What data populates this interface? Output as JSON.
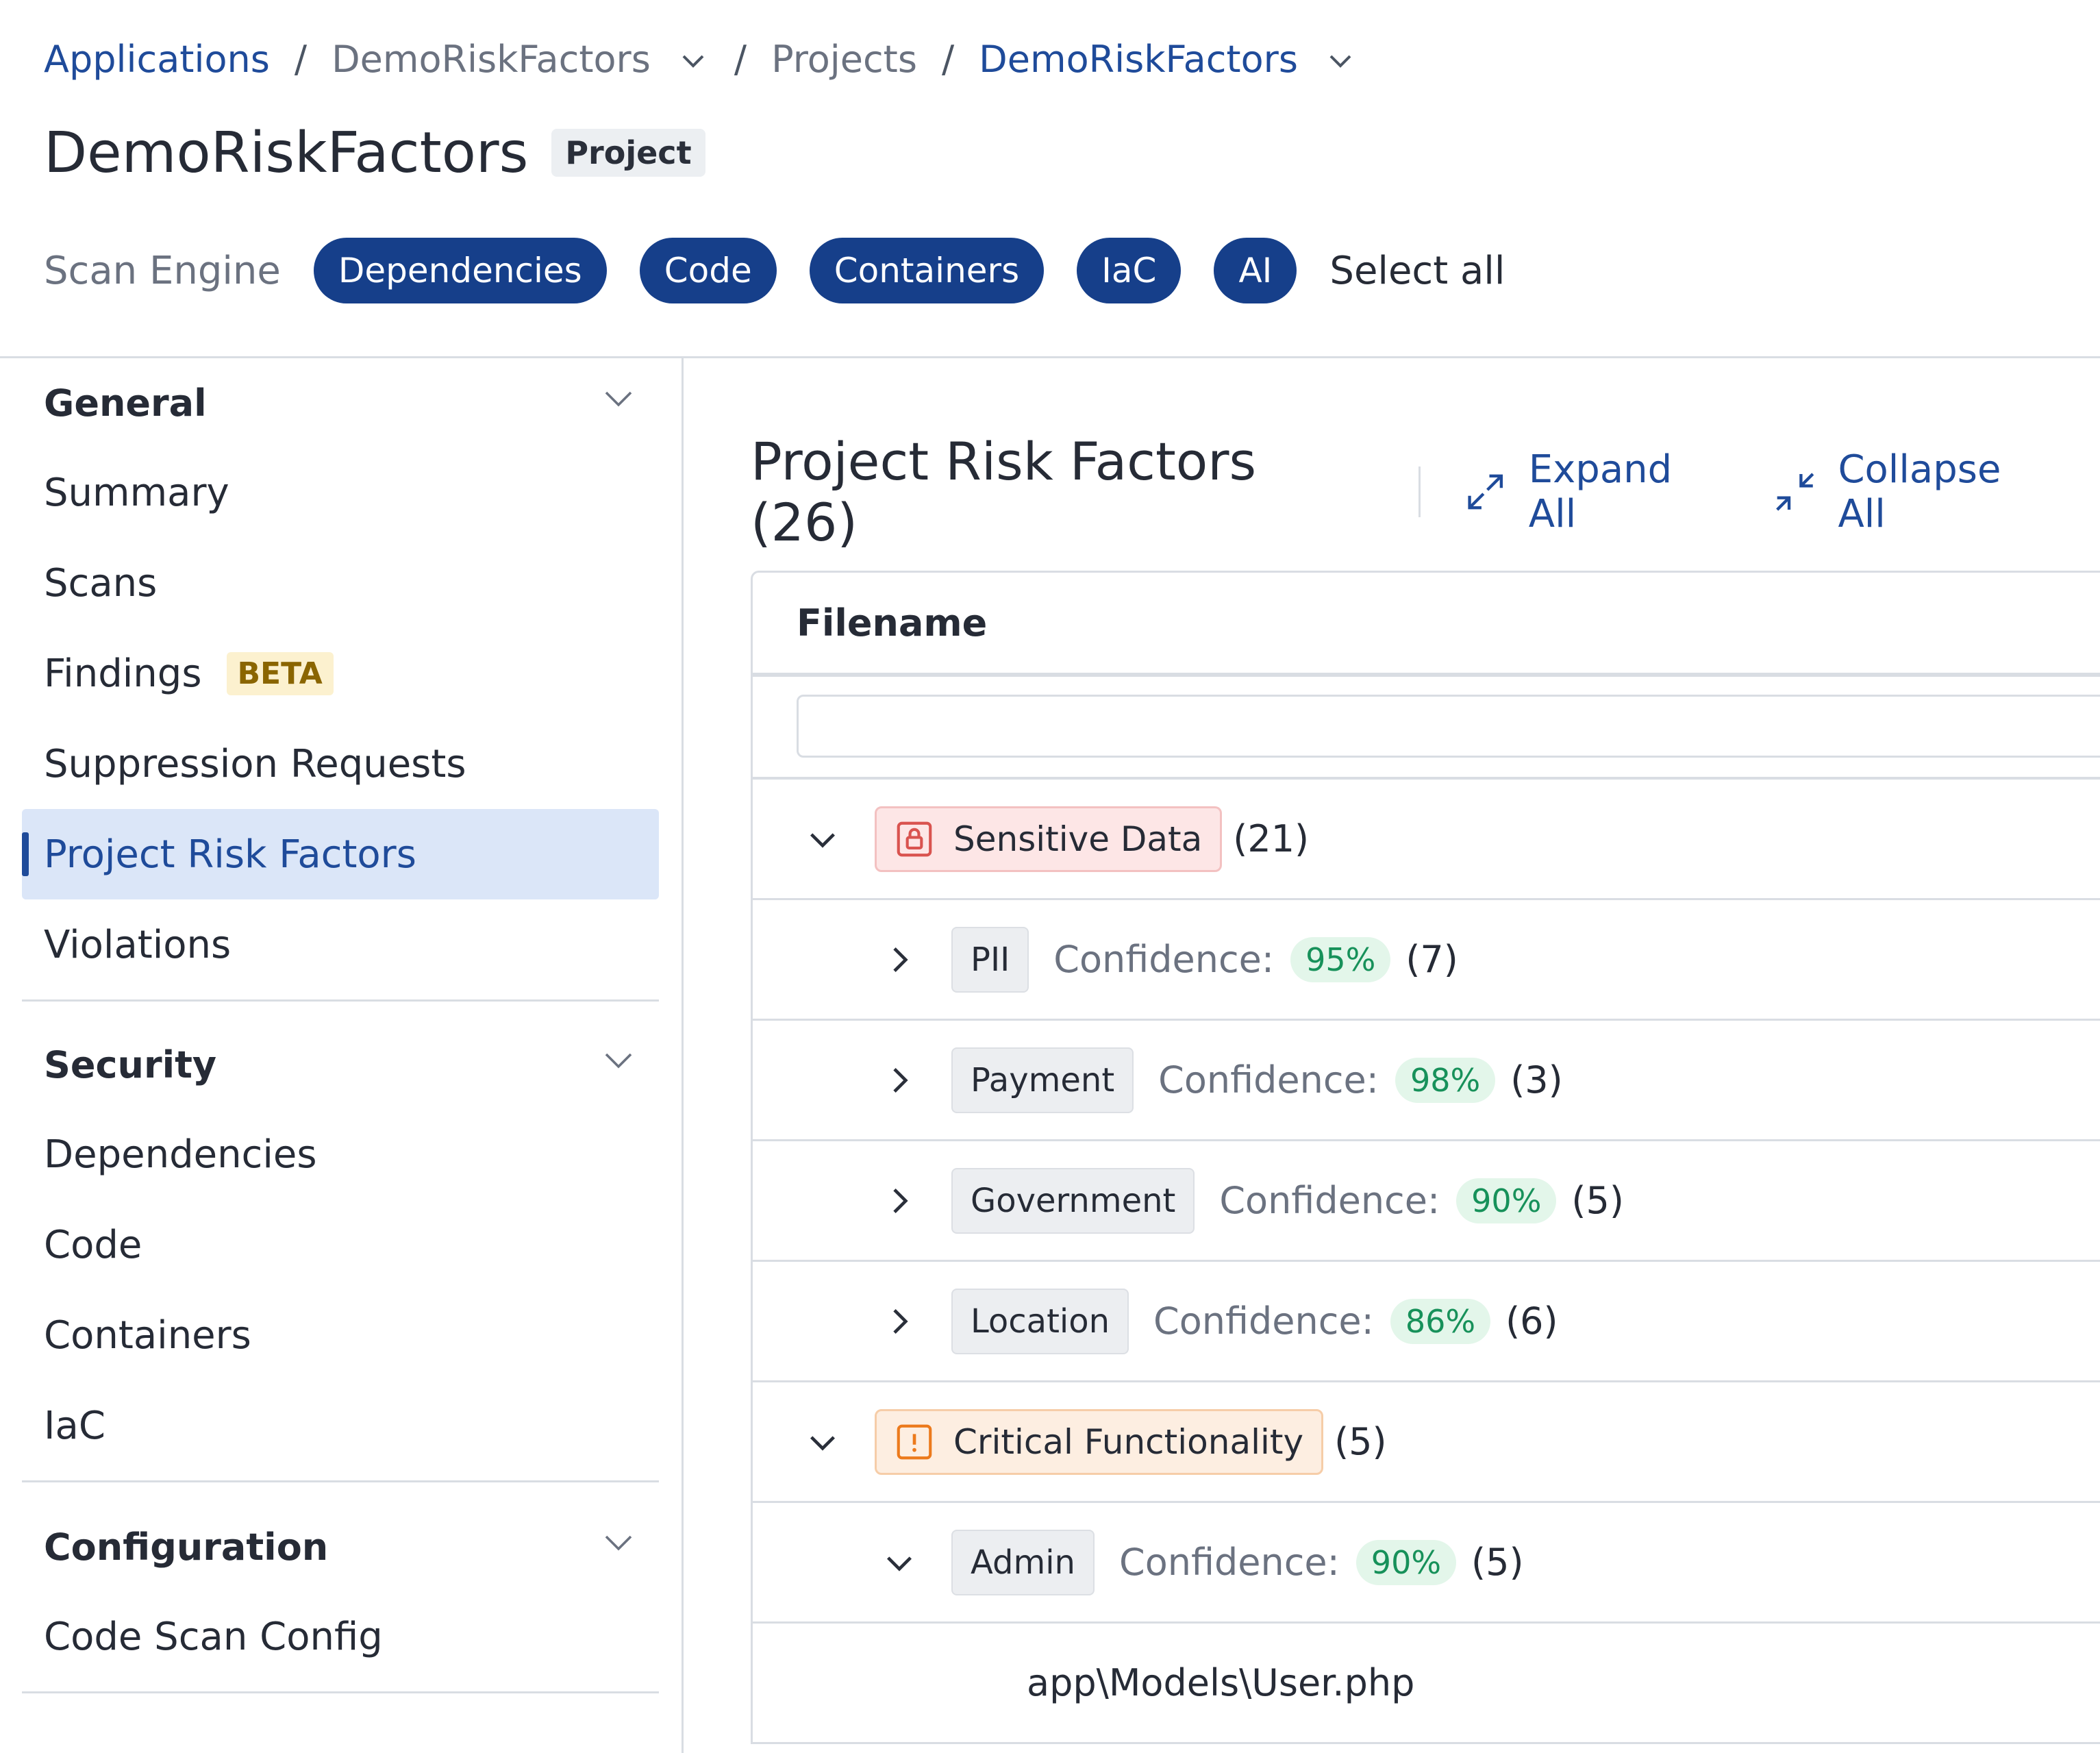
{
  "breadcrumb": {
    "applications": "Applications",
    "sep": "/",
    "app": "DemoRiskFactors",
    "projects": "Projects",
    "project": "DemoRiskFactors"
  },
  "header": {
    "title": "DemoRiskFactors",
    "tag": "Project",
    "scan_engine_label": "Scan Engine",
    "engines": [
      "Dependencies",
      "Code",
      "Containers",
      "IaC",
      "AI"
    ],
    "select_all": "Select all"
  },
  "sidebar": {
    "general": {
      "title": "General",
      "items": [
        "Summary",
        "Scans",
        "Findings",
        "Suppression Requests",
        "Project Risk Factors",
        "Violations"
      ],
      "beta_badge": "BETA"
    },
    "security": {
      "title": "Security",
      "items": [
        "Dependencies",
        "Code",
        "Containers",
        "IaC"
      ]
    },
    "configuration": {
      "title": "Configuration",
      "items": [
        "Code Scan Config"
      ]
    }
  },
  "main": {
    "title": "Project Risk Factors (26)",
    "expand_all": "Expand All",
    "collapse_all": "Collapse All",
    "column_header": "Filename",
    "filter_value": "",
    "confidence_label": "Confidence:",
    "groups": [
      {
        "label": "Sensitive Data",
        "count": "(21)",
        "color": "#d9534f",
        "subs": [
          {
            "label": "PII",
            "confidence": "95%",
            "count": "(7)"
          },
          {
            "label": "Payment",
            "confidence": "98%",
            "count": "(3)"
          },
          {
            "label": "Government",
            "confidence": "90%",
            "count": "(5)"
          },
          {
            "label": "Location",
            "confidence": "86%",
            "count": "(6)"
          }
        ]
      },
      {
        "label": "Critical Functionality",
        "count": "(5)",
        "color": "#ec7a1c",
        "subs": [
          {
            "label": "Admin",
            "confidence": "90%",
            "count": "(5)",
            "files": [
              "app\\Models\\User.php"
            ]
          }
        ]
      }
    ]
  },
  "colors": {
    "accent": "#163f8a",
    "link": "#1f4b9a",
    "confidence_green": "#17915a",
    "active_nav_bg": "#dbe6f8"
  }
}
